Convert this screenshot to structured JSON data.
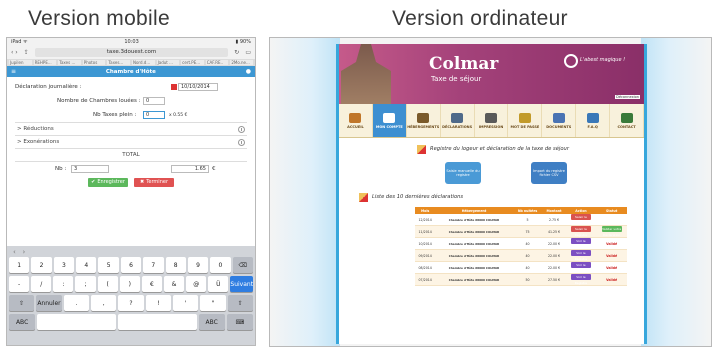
{
  "headings": {
    "mobile": "Version mobile",
    "desktop": "Version ordinateur"
  },
  "mobile": {
    "status_time": "10:03",
    "url": "taxe.3douest.com",
    "tabs": [
      "Jupilen",
      "REHPE...",
      "Taxes ...",
      "Photos",
      "Taxes...",
      "Nord.d...",
      "Jadut ...",
      "cert.PE...",
      "CAF.RE..",
      "2Mo.ne..."
    ],
    "app_title": "Chambre d'Hôte",
    "decl_label": "Déclaration journalière :",
    "date_value": "10/10/2014",
    "rooms_label": "Nombre de Chambres louées :",
    "rooms_value": "0",
    "nuits_label": "Nb Taxes plein :",
    "nuits_value": "0",
    "nuits_price": "x 0.55 €",
    "reductions": "> Réductions",
    "exonerations": "> Exonérations",
    "total_label": "TOTAL",
    "nb_label": "Nb :",
    "nb_value": "3",
    "amount_value": "1.65",
    "amount_unit": "€",
    "save_label": "Enregistrer",
    "cancel_label": "Terminer",
    "kb_rows": [
      [
        "1",
        "2",
        "3",
        "4",
        "5",
        "6",
        "7",
        "8",
        "9",
        "0",
        "⌫"
      ],
      [
        "-",
        "/",
        ":",
        ";",
        "(",
        ")",
        "€",
        "&",
        "@",
        "Ü",
        "Suivant"
      ],
      [
        "⇧",
        "Annuler",
        ".",
        ",",
        "?",
        "!",
        "'",
        "\"",
        "⇧"
      ],
      [
        "ABC",
        "",
        "",
        "ABC",
        "⌨"
      ]
    ]
  },
  "desktop": {
    "city": "Colmar",
    "subtitle": "Taxe de séjour",
    "motto": "L'abest magique !",
    "logout": "Déconnexion",
    "nav": [
      {
        "label": "ACCUEIL",
        "color": "#c0762a"
      },
      {
        "label": "MON COMPTE",
        "color": "#ffffff"
      },
      {
        "label": "HÉBERGEMENTS",
        "color": "#7a5a2a"
      },
      {
        "label": "DÉCLARATIONS",
        "color": "#4f6a8a"
      },
      {
        "label": "IMPRESSION",
        "color": "#5a5a5a"
      },
      {
        "label": "MOT DE PASSE",
        "color": "#c29a2a"
      },
      {
        "label": "DOCUMENTS",
        "color": "#4a73b3"
      },
      {
        "label": "F.A.Q",
        "color": "#3a78b8"
      },
      {
        "label": "CONTACT",
        "color": "#3a7a3a"
      }
    ],
    "registre_title": "Registre du logeur et déclaration de la taxe de séjour",
    "doc1": "Saisie manuelle du registre",
    "doc2": "Import du registre fichier CSV",
    "list_title": "Liste des 10 dernières déclarations",
    "table_headers": [
      "Mois",
      "Hébergement",
      "Nb nuitées",
      "Montant",
      "Action",
      "Statut"
    ],
    "rows": [
      {
        "mois": "12/2014",
        "heb": "Chambre d'Hôte 68000 COLMAR",
        "nb": "5",
        "montant": "2.75 €",
        "action": "Saisir le Registre",
        "statut": ""
      },
      {
        "mois": "11/2014",
        "heb": "Chambre d'Hôte 68000 COLMAR",
        "nb": "75",
        "montant": "41.25 €",
        "action": "Saisir le Registre",
        "statut": "Valider votre Déclaration"
      },
      {
        "mois": "10/2014",
        "heb": "Chambre d'Hôte 68000 COLMAR",
        "nb": "40",
        "montant": "22.00 €",
        "action": "Voir le Registre",
        "statut": "Validé"
      },
      {
        "mois": "09/2014",
        "heb": "Chambre d'Hôte 68000 COLMAR",
        "nb": "40",
        "montant": "22.00 €",
        "action": "Voir le Registre",
        "statut": "Validé"
      },
      {
        "mois": "08/2014",
        "heb": "Chambre d'Hôte 68000 COLMAR",
        "nb": "40",
        "montant": "22.00 €",
        "action": "Voir le Registre",
        "statut": "Validé"
      },
      {
        "mois": "07/2014",
        "heb": "Chambre d'Hôte 68000 COLMAR",
        "nb": "50",
        "montant": "27.50 €",
        "action": "Voir le Registre",
        "statut": "Validé"
      }
    ]
  }
}
